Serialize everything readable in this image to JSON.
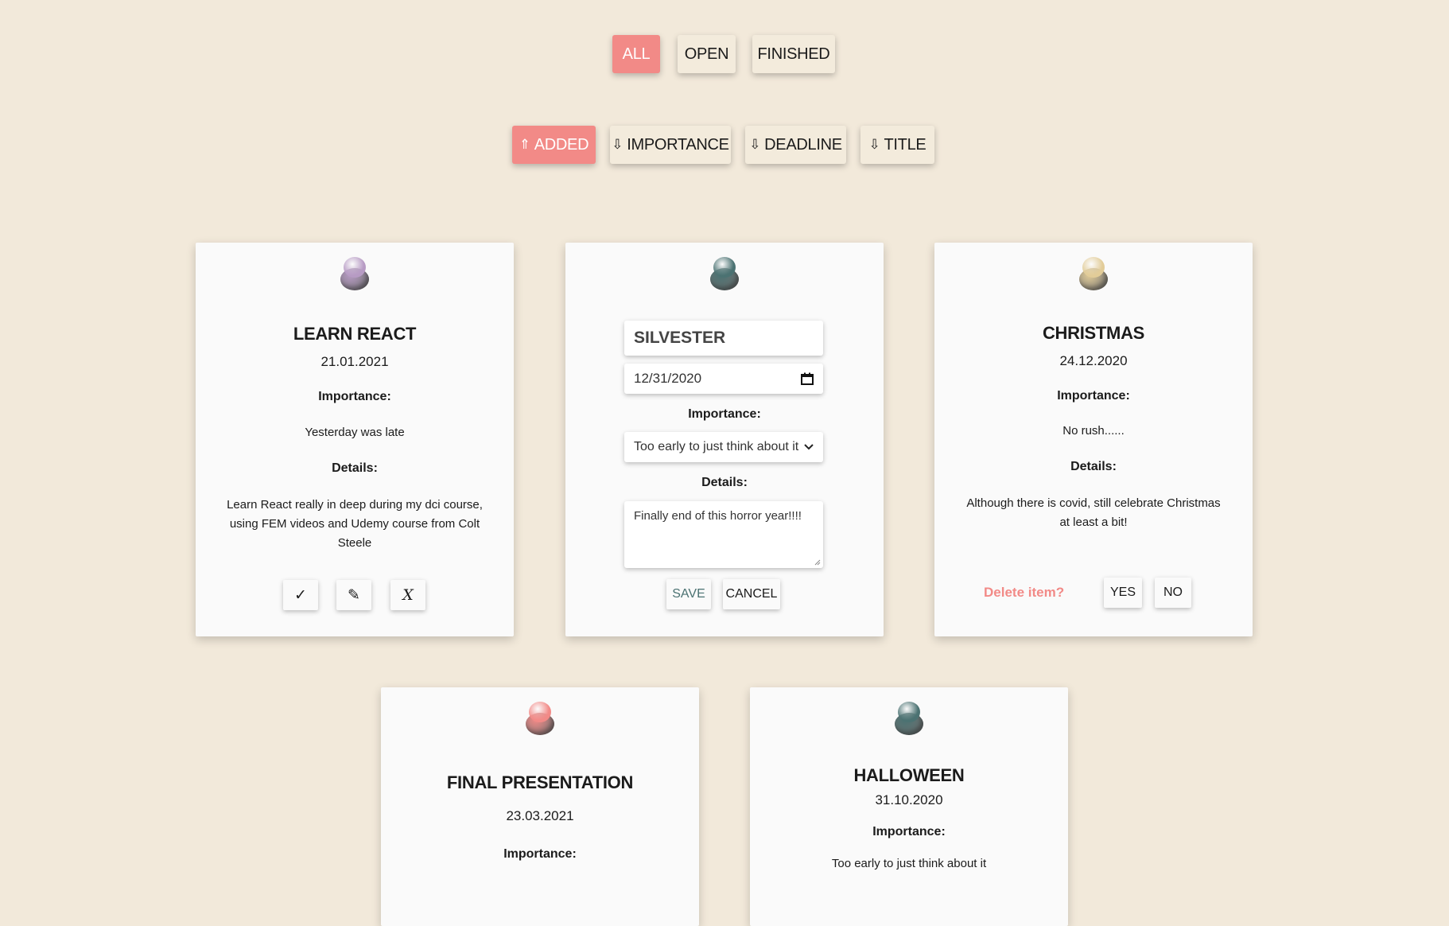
{
  "filters": {
    "all": "ALL",
    "open": "OPEN",
    "finished": "FINISHED"
  },
  "sorts": {
    "added": {
      "arrow": "⇑",
      "label": "ADDED"
    },
    "importance": {
      "arrow": "⇩",
      "label": "IMPORTANCE"
    },
    "deadline": {
      "arrow": "⇩",
      "label": "DEADLINE"
    },
    "title": {
      "arrow": "⇩",
      "label": "TITLE"
    }
  },
  "colors": {
    "accent": "#f28a87",
    "background": "#f2e9da",
    "card": "#fafafa"
  },
  "cards": [
    {
      "pin_color": "#b79bc4",
      "title": "LEARN REACT",
      "date": "21.01.2021",
      "importance_label": "Importance:",
      "importance": "Yesterday was late",
      "details_label": "Details:",
      "details": "Learn React really in deep during my dci course, using FEM videos and Udemy course from Colt Steele",
      "actions": {
        "done": "✓",
        "edit": "✎",
        "delete": "X"
      }
    },
    {
      "pin_color": "#4b7272",
      "edit_mode": true,
      "title_value": "SILVESTER",
      "date_value": "12/31/2020",
      "importance_label": "Importance:",
      "importance_selected": "Too early to just think about it",
      "details_label": "Details:",
      "details_value": "Finally end of this horror year!!!!",
      "save": "SAVE",
      "cancel": "CANCEL"
    },
    {
      "pin_color": "#e2cc98",
      "title": "CHRISTMAS",
      "date": "24.12.2020",
      "importance_label": "Importance:",
      "importance": "No rush......",
      "details_label": "Details:",
      "details": "Although there is covid, still celebrate Christmas at least a bit!",
      "confirm_text": "Delete item?",
      "yes": "YES",
      "no": "NO"
    },
    {
      "pin_color": "#f28a87",
      "title": "FINAL PRESENTATION",
      "date": "23.03.2021",
      "importance_label": "Importance:"
    },
    {
      "pin_color": "#4b7272",
      "title": "HALLOWEEN",
      "date": "31.10.2020",
      "importance_label": "Importance:",
      "importance": "Too early to just think about it"
    }
  ]
}
